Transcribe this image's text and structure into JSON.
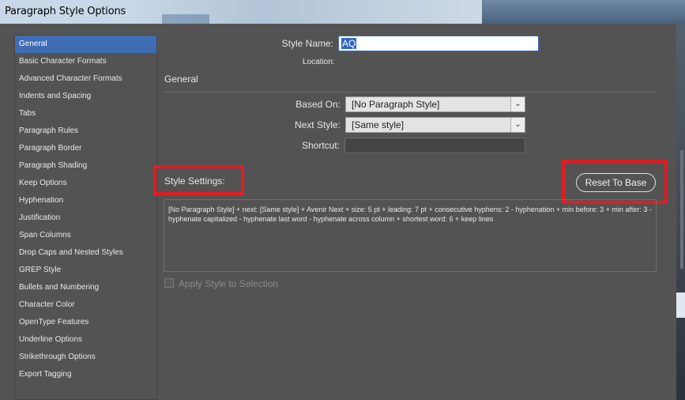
{
  "window": {
    "title": "Paragraph Style Options"
  },
  "sidebar": {
    "items": [
      {
        "label": "General",
        "active": true
      },
      {
        "label": "Basic Character Formats"
      },
      {
        "label": "Advanced Character Formats"
      },
      {
        "label": "Indents and Spacing"
      },
      {
        "label": "Tabs"
      },
      {
        "label": "Paragraph Rules"
      },
      {
        "label": "Paragraph Border"
      },
      {
        "label": "Paragraph Shading"
      },
      {
        "label": "Keep Options"
      },
      {
        "label": "Hyphenation"
      },
      {
        "label": "Justification"
      },
      {
        "label": "Span Columns"
      },
      {
        "label": "Drop Caps and Nested Styles"
      },
      {
        "label": "GREP Style"
      },
      {
        "label": "Bullets and Numbering"
      },
      {
        "label": "Character Color"
      },
      {
        "label": "OpenType Features"
      },
      {
        "label": "Underline Options"
      },
      {
        "label": "Strikethrough Options"
      },
      {
        "label": "Export Tagging"
      }
    ]
  },
  "main": {
    "style_name_label": "Style Name:",
    "style_name_value": "AQ",
    "location_label": "Location:",
    "section_title": "General",
    "based_on_label": "Based On:",
    "based_on_value": "[No Paragraph Style]",
    "next_style_label": "Next Style:",
    "next_style_value": "[Same style]",
    "shortcut_label": "Shortcut:",
    "shortcut_value": "",
    "style_settings_label": "Style Settings:",
    "reset_button": "Reset To Base",
    "style_settings_text": "[No Paragraph Style] + next: [Same style] + Avenir Next + size: 5 pt + leading: 7 pt + consecutive hyphens: 2 - hyphenation + min before: 3 + min after: 3 - hyphenate capitalized - hyphenate last word - hyphenate across column + shortest word: 6 + keep lines",
    "apply_label": "Apply Style to Selection",
    "apply_checked": false
  },
  "colors": {
    "dialog_bg": "#535353",
    "selection_blue": "#3f6db4",
    "highlight_red": "#e41b23"
  }
}
